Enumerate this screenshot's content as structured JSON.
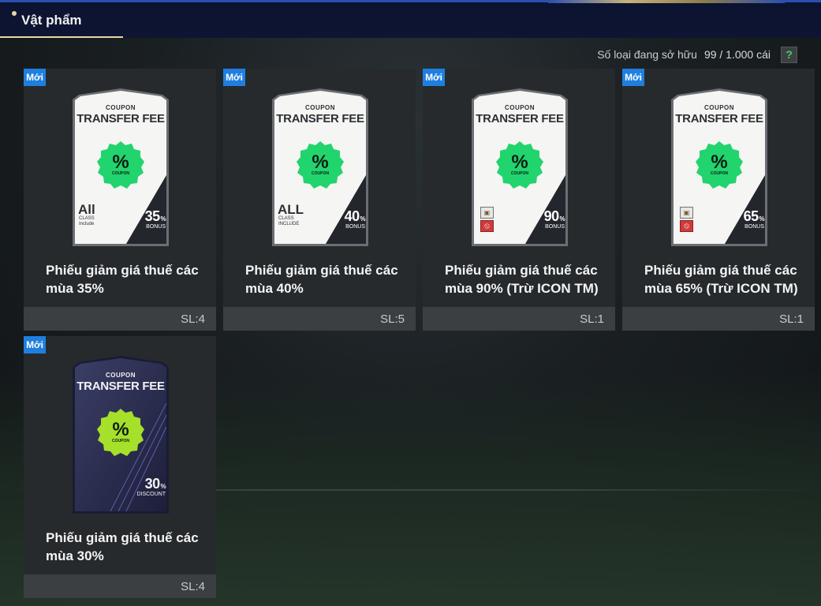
{
  "header": {
    "tab_label": "Vật phẩm"
  },
  "inventory": {
    "owned_label": "Số loại đang sở hữu",
    "owned_count": "99 / 1.000 cái",
    "help_label": "?"
  },
  "colors": {
    "new_badge": "#1f7fe0",
    "coupon_green": "#22d46d",
    "coupon_lime": "#a6e02a",
    "header_bg": "#0b1330"
  },
  "items": [
    {
      "badge": "Mới",
      "name_line1": "Phiếu giảm giá thuế các",
      "name_line2": "mùa 35%",
      "qty": "SL:4",
      "card": {
        "top_small": "COUPON",
        "title": "TRANSFER FEE",
        "pct_symbol": "%",
        "pct_sub": "COUPON",
        "value": "35",
        "unit": "%",
        "value_sub": "BONUS",
        "class_main": "All",
        "class_sub1": "CLASS",
        "class_sub2": "Include"
      }
    },
    {
      "badge": "Mới",
      "name_line1": "Phiếu giảm giá thuế các",
      "name_line2": "mùa 40%",
      "qty": "SL:5",
      "card": {
        "top_small": "COUPON",
        "title": "TRANSFER FEE",
        "pct_symbol": "%",
        "pct_sub": "COUPON",
        "value": "40",
        "unit": "%",
        "value_sub": "BONUS",
        "class_main": "ALL",
        "class_sub1": "CLASS",
        "class_sub2": "INCLUDE"
      }
    },
    {
      "badge": "Mới",
      "name_line1": "Phiếu giảm giá thuế các",
      "name_line2": "mùa 90% (Trừ ICON TM)",
      "qty": "SL:1",
      "card": {
        "top_small": "COUPON",
        "title": "TRANSFER FEE",
        "pct_symbol": "%",
        "pct_sub": "COUPON",
        "value": "90",
        "unit": "%",
        "value_sub": "BONUS",
        "restrict_icon": "icon-card-icon",
        "restrict_ban": "prohibited-icon"
      }
    },
    {
      "badge": "Mới",
      "name_line1": "Phiếu giảm giá thuế các",
      "name_line2": "mùa 65% (Trừ ICON TM)",
      "qty": "SL:1",
      "card": {
        "top_small": "COUPON",
        "title": "TRANSFER FEE",
        "pct_symbol": "%",
        "pct_sub": "COUPON",
        "value": "65",
        "unit": "%",
        "value_sub": "BONUS",
        "restrict_icon": "icon-card-icon",
        "restrict_ban": "prohibited-icon"
      }
    },
    {
      "badge": "Mới",
      "name_line1": "Phiếu giảm giá thuế các",
      "name_line2": "mùa 30%",
      "qty": "SL:4",
      "card": {
        "top_small": "COUPON",
        "title": "TRANSFER FEE",
        "pct_symbol": "%",
        "pct_sub": "COUPON",
        "value": "30",
        "unit": "%",
        "value_sub": "DISCOUNT"
      }
    }
  ]
}
